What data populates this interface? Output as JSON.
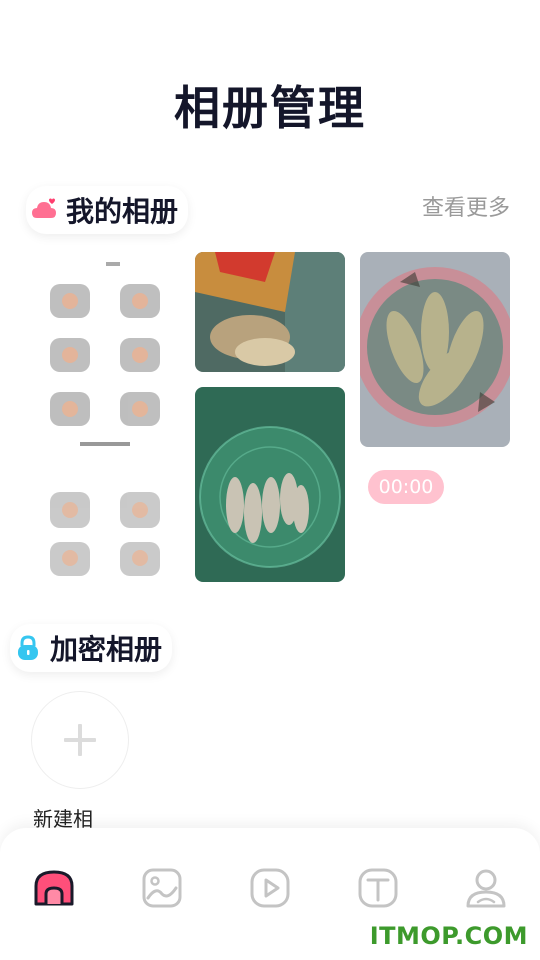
{
  "header": {
    "title": "相册管理"
  },
  "my_albums": {
    "label": "我的相册",
    "more_label": "查看更多",
    "video_duration": "00:00",
    "icon": "cloud-heart-icon",
    "accent": "#ff5f86"
  },
  "encrypted_albums": {
    "label": "加密相册",
    "icon": "lock-icon",
    "accent": "#35c6f0",
    "new_album_label": "新建相"
  },
  "tabbar": {
    "tabs": [
      {
        "icon": "home-icon",
        "active": true
      },
      {
        "icon": "photo-icon",
        "active": false
      },
      {
        "icon": "play-icon",
        "active": false
      },
      {
        "icon": "text-icon",
        "active": false
      },
      {
        "icon": "profile-icon",
        "active": false
      }
    ],
    "active_color": "#ff4f7a"
  },
  "watermark": {
    "text": "ITMOP.COM"
  }
}
